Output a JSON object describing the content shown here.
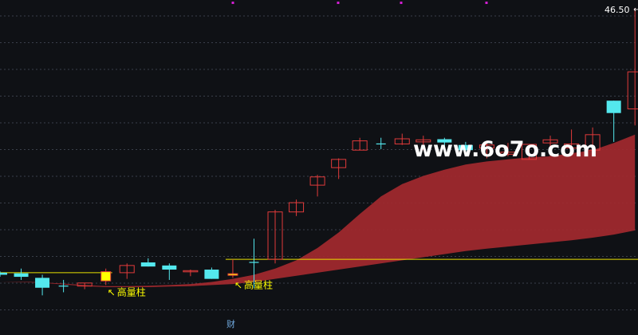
{
  "chart_data": {
    "type": "candlestick",
    "price_range": [
      31.4,
      46.5
    ],
    "candles": [
      {
        "o": 33.65,
        "h": 33.72,
        "l": 33.45,
        "c": 33.55
      },
      {
        "o": 33.62,
        "h": 33.85,
        "l": 33.3,
        "c": 33.45
      },
      {
        "o": 33.4,
        "h": 33.55,
        "l": 32.55,
        "c": 32.92
      },
      {
        "o": 33.0,
        "h": 33.3,
        "l": 32.7,
        "c": 33.0
      },
      {
        "o": 33.0,
        "h": 33.15,
        "l": 32.85,
        "c": 33.15
      },
      {
        "o": 33.25,
        "h": 33.85,
        "l": 33.05,
        "c": 33.7
      },
      {
        "o": 33.65,
        "h": 34.1,
        "l": 33.35,
        "c": 34.0
      },
      {
        "o": 34.15,
        "h": 34.35,
        "l": 33.95,
        "c": 33.95
      },
      {
        "o": 34.0,
        "h": 34.1,
        "l": 33.3,
        "c": 33.8
      },
      {
        "o": 33.7,
        "h": 33.8,
        "l": 33.48,
        "c": 33.75
      },
      {
        "o": 33.8,
        "h": 33.9,
        "l": 33.35,
        "c": 33.35
      },
      {
        "o": 33.6,
        "h": 34.3,
        "l": 33.4,
        "c": 33.6
      },
      {
        "o": 34.15,
        "h": 35.3,
        "l": 32.9,
        "c": 34.15
      },
      {
        "o": 34.3,
        "h": 36.7,
        "l": 34.1,
        "c": 36.6
      },
      {
        "o": 36.6,
        "h": 37.2,
        "l": 36.4,
        "c": 37.05
      },
      {
        "o": 37.9,
        "h": 38.4,
        "l": 37.35,
        "c": 38.3
      },
      {
        "o": 38.75,
        "h": 39.2,
        "l": 38.2,
        "c": 39.15
      },
      {
        "o": 39.6,
        "h": 40.2,
        "l": 39.6,
        "c": 40.05
      },
      {
        "o": 39.9,
        "h": 40.2,
        "l": 39.65,
        "c": 39.9
      },
      {
        "o": 39.9,
        "h": 40.4,
        "l": 39.85,
        "c": 40.15
      },
      {
        "o": 40.0,
        "h": 40.3,
        "l": 39.6,
        "c": 40.1
      },
      {
        "o": 40.13,
        "h": 40.2,
        "l": 39.7,
        "c": 39.97
      },
      {
        "o": 39.85,
        "h": 40.0,
        "l": 39.4,
        "c": 39.6
      },
      {
        "o": 39.7,
        "h": 40.0,
        "l": 39.2,
        "c": 39.85
      },
      {
        "o": 39.4,
        "h": 39.95,
        "l": 39.3,
        "c": 39.5
      },
      {
        "o": 39.15,
        "h": 39.8,
        "l": 39.15,
        "c": 39.88
      },
      {
        "o": 39.95,
        "h": 40.3,
        "l": 39.3,
        "c": 40.1
      },
      {
        "o": 39.7,
        "h": 40.6,
        "l": 39.6,
        "c": 39.9
      },
      {
        "o": 39.6,
        "h": 40.7,
        "l": 39.4,
        "c": 40.35
      },
      {
        "o": 42.0,
        "h": 42.0,
        "l": 40.0,
        "c": 41.4
      },
      {
        "o": 41.6,
        "h": 46.5,
        "l": 40.8,
        "c": 43.4
      }
    ],
    "band_upper": [
      33.2,
      33.22,
      33.18,
      33.12,
      33.05,
      33.0,
      33.0,
      33.02,
      33.05,
      33.1,
      33.2,
      33.35,
      33.55,
      33.85,
      34.25,
      34.85,
      35.6,
      36.5,
      37.35,
      37.95,
      38.35,
      38.65,
      38.9,
      39.05,
      39.15,
      39.25,
      39.3,
      39.45,
      39.6,
      39.95,
      40.35
    ],
    "band_lower": [
      33.2,
      33.2,
      33.15,
      33.08,
      33.0,
      32.95,
      32.95,
      32.95,
      32.98,
      33.0,
      33.05,
      33.1,
      33.2,
      33.35,
      33.5,
      33.65,
      33.8,
      33.95,
      34.1,
      34.25,
      34.4,
      34.55,
      34.7,
      34.82,
      34.92,
      35.02,
      35.12,
      35.22,
      35.35,
      35.5,
      35.7
    ],
    "volume_pillars": [
      {
        "index": 5,
        "label": "高量柱"
      },
      {
        "index": 11,
        "label": "高量柱"
      }
    ],
    "reference_lines": [
      {
        "price": 33.65,
        "from_index": 0,
        "to_index": 5
      },
      {
        "price": 34.3,
        "from_index": 11,
        "to_index": 30
      }
    ],
    "max_label": "46.50",
    "bottom_label": "财",
    "watermark": "www.6o7o.com",
    "colors": {
      "background": "#0f1115",
      "up": "#e03a3a",
      "down": "#54e8ee",
      "band": "#a3292f",
      "volume_pillar": "#ffff00",
      "reference_line": "#e8e000",
      "marker": "#d21fd2",
      "label": "#ffffff",
      "grid": "#3a3f4a"
    }
  }
}
